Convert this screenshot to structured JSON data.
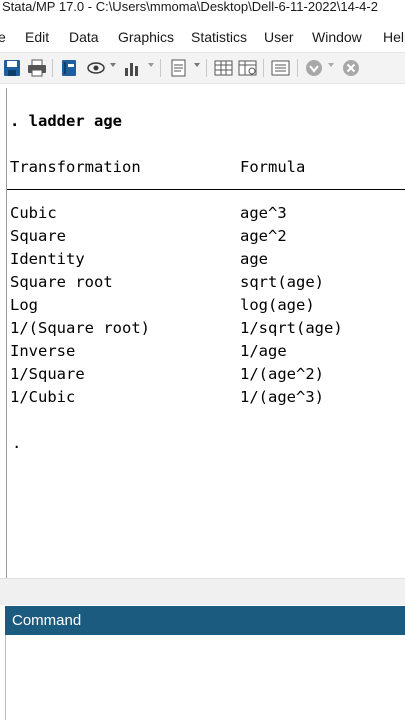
{
  "window": {
    "title": "Stata/MP 17.0 - C:\\Users\\mmoma\\Desktop\\Dell-6-11-2022\\14-4-2"
  },
  "menu": [
    "e",
    "Edit",
    "Data",
    "Graphics",
    "Statistics",
    "User",
    "Window",
    "Help"
  ],
  "toolbar": {
    "icons": [
      "save-icon",
      "print-icon",
      "log-icon",
      "viewer-icon",
      "graph-icon",
      "do-file-editor-icon",
      "data-editor-icon",
      "data-browser-icon",
      "variables-manager-icon",
      "more-icon",
      "break-icon"
    ]
  },
  "results": {
    "command": ". ladder age",
    "headers": {
      "transformation": "Transformation",
      "formula": "Formula"
    },
    "rows": [
      {
        "transformation": "Cubic",
        "formula": "age^3"
      },
      {
        "transformation": "Square",
        "formula": "age^2"
      },
      {
        "transformation": "Identity",
        "formula": "age"
      },
      {
        "transformation": "Square root",
        "formula": "sqrt(age)"
      },
      {
        "transformation": "Log",
        "formula": "log(age)"
      },
      {
        "transformation": "1/(Square root)",
        "formula": "1/sqrt(age)"
      },
      {
        "transformation": "Inverse",
        "formula": "1/age"
      },
      {
        "transformation": "1/Square",
        "formula": "1/(age^2)"
      },
      {
        "transformation": "1/Cubic",
        "formula": "1/(age^3)"
      }
    ],
    "prompt": "."
  },
  "command_panel": {
    "title": "Command",
    "value": ""
  },
  "colors": {
    "command_header": "#1c5b80",
    "toolbar_bg": "#f3f3f3",
    "icon_blue": "#1e5f9e"
  }
}
